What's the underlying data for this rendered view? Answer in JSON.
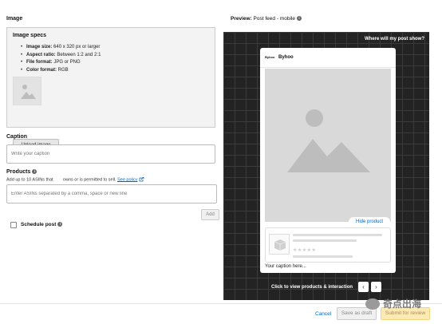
{
  "form": {
    "image_section_title": "Image",
    "specs": {
      "title": "Image specs",
      "items": [
        {
          "label": "Image size:",
          "value": "640 x 320 px or larger"
        },
        {
          "label": "Aspect ratio:",
          "value": "Between 1:2 and 2:1"
        },
        {
          "label": "File format:",
          "value": "JPG or PNG"
        },
        {
          "label": "Color format:",
          "value": "RGB"
        }
      ],
      "upload_button": "Upload image"
    },
    "caption": {
      "label": "Caption",
      "placeholder": "Write your caption"
    },
    "products": {
      "label": "Products",
      "note": "Add up to 10 ASINs that        owns or is permitted to sell.",
      "policy_link": "See policy",
      "placeholder": "Enter ASINs separated by a comma, space or new line",
      "add_button": "Add"
    },
    "schedule": {
      "label": "Schedule post"
    }
  },
  "preview": {
    "title_bold": "Preview:",
    "title_rest": " Post feed - mobile",
    "where_link": "Where will my post show?",
    "brand_logo_text": "Byhoo",
    "brand_name": "Byhoo",
    "hide_product": "Hide product",
    "caption_preview": "Your caption here...",
    "stars": "★★★★★",
    "click_text": "Click to view products & interaction",
    "prev_icon": "‹",
    "next_icon": "›"
  },
  "footer": {
    "cancel": "Cancel",
    "save_draft": "Save as draft",
    "submit": "Submit for review"
  },
  "watermark": {
    "text": "奇点出海"
  },
  "colors": {
    "link": "#0066c0",
    "preview_bg": "#232323",
    "submit_bg": "#fce9b4"
  }
}
